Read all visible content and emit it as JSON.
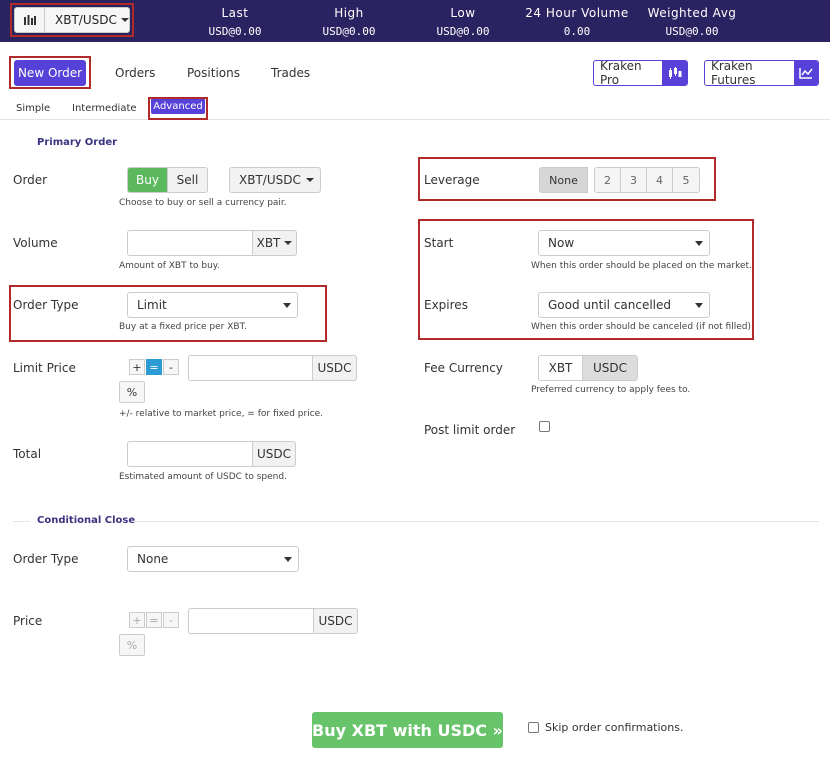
{
  "header": {
    "pair": "XBT/USDC",
    "stats": [
      {
        "label": "Last",
        "value": "USD@0.00"
      },
      {
        "label": "High",
        "value": "USD@0.00"
      },
      {
        "label": "Low",
        "value": "USD@0.00"
      },
      {
        "label": "24 Hour Volume",
        "value": "0.00"
      },
      {
        "label": "Weighted Avg",
        "value": "USD@0.00"
      }
    ]
  },
  "nav": {
    "new_order": "New Order",
    "orders": "Orders",
    "positions": "Positions",
    "trades": "Trades",
    "kraken_pro": "Kraken Pro",
    "kraken_futures": "Kraken Futures"
  },
  "subtabs": {
    "simple": "Simple",
    "intermediate": "Intermediate",
    "advanced": "Advanced"
  },
  "primary": {
    "title": "Primary Order",
    "order_label": "Order",
    "buy": "Buy",
    "sell": "Sell",
    "pair": "XBT/USDC",
    "order_help": "Choose to buy or sell a currency pair.",
    "volume_label": "Volume",
    "volume_unit": "XBT",
    "volume_help": "Amount of XBT to buy.",
    "order_type_label": "Order Type",
    "order_type_value": "Limit",
    "order_type_help": "Buy at a fixed price per XBT.",
    "limit_price_label": "Limit Price",
    "limit_unit": "USDC",
    "plus": "+",
    "equals": "=",
    "minus": "-",
    "percent": "%",
    "limit_help": "+/- relative to market price, = for fixed price.",
    "total_label": "Total",
    "total_unit": "USDC",
    "total_help": "Estimated amount of USDC to spend."
  },
  "right": {
    "leverage_label": "Leverage",
    "leverage_options": [
      "None",
      "2",
      "3",
      "4",
      "5"
    ],
    "start_label": "Start",
    "start_value": "Now",
    "start_help": "When this order should be placed on the market.",
    "expires_label": "Expires",
    "expires_value": "Good until cancelled",
    "expires_help": "When this order should be canceled (if not filled).",
    "fee_label": "Fee Currency",
    "fee_xbt": "XBT",
    "fee_usdc": "USDC",
    "fee_help": "Preferred currency to apply fees to.",
    "post_limit_label": "Post limit order"
  },
  "conditional": {
    "title": "Conditional Close",
    "order_type_label": "Order Type",
    "order_type_value": "None",
    "price_label": "Price",
    "price_unit": "USDC",
    "plus": "+",
    "equals": "=",
    "minus": "-",
    "percent": "%"
  },
  "footer": {
    "submit": "Buy XBT with USDC »",
    "skip_confirm": "Skip order confirmations."
  },
  "colors": {
    "brand": "#5741d9",
    "header_bg": "#2b2361",
    "buy": "#5cb85c"
  }
}
